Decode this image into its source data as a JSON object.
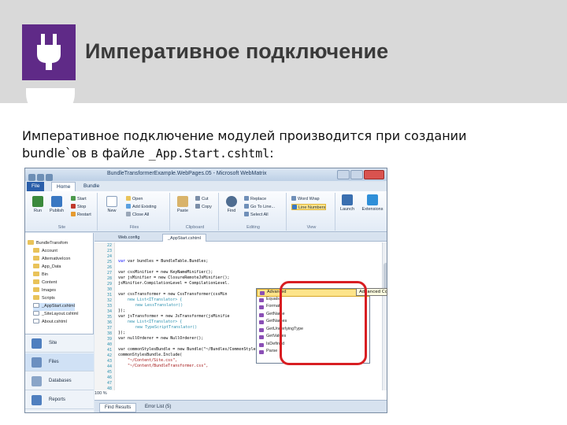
{
  "slide": {
    "title": "Императивное подключение",
    "body_line1": "Императивное подключение модулей производится при создании",
    "body_line2_prefix": "bundle`ов в файле ",
    "body_line2_code": "_App.Start.cshtml",
    "body_line2_suffix": ":",
    "logo_icon": "power-plug-icon",
    "accent_color": "#5f2a87",
    "header_color": "#d9d9d9"
  },
  "app": {
    "window_title": "BundleTransformerExample.WebPages.05 - Microsoft WebMatrix",
    "tabs": [
      "File",
      "Home",
      "Bundle"
    ],
    "ribbon": {
      "run": "Run",
      "publish": "Publish",
      "start": "Start",
      "stop": "Stop",
      "restart": "Restart",
      "new": "New",
      "open": "Open",
      "add_existing": "Add Existing",
      "close_all": "Close All",
      "paste": "Paste",
      "cut": "Cut",
      "copy": "Copy",
      "find": "Find",
      "replace": "Replace",
      "goto": "Go To Line...",
      "select_all": "Select All",
      "word_wrap": "Word Wrap",
      "line_numbers": "Line Numbers",
      "launch": "Launch",
      "extensions": "Extensions",
      "group_site": "Site",
      "group_files": "Files",
      "group_clipboard": "Clipboard",
      "group_editing": "Editing",
      "group_view": "View"
    },
    "tree": {
      "root": "BundleTransfom",
      "items": [
        "Account",
        "AlternativeIcon",
        "App_Data",
        "Bin",
        "Content",
        "Images",
        "Scripts",
        "_AppStart.cshtml",
        "_SiteLayout.cshtml",
        "About.cshtml"
      ]
    },
    "workspaces": [
      "Site",
      "Files",
      "Databases",
      "Reports"
    ],
    "editor_tabs": [
      "Web.config",
      "_AppStart.cshtml"
    ],
    "zoom": "100 %",
    "bottom_tabs": [
      "Find Results",
      "Error List (5)"
    ],
    "line_numbers": [
      "22",
      "23",
      "24",
      "25",
      "26",
      "27",
      "28",
      "29",
      "30",
      "31",
      "32",
      "33",
      "34",
      "35",
      "36",
      "37",
      "38",
      "39",
      "40",
      "41",
      "42",
      "43",
      "44",
      "45",
      "46",
      "47",
      "48"
    ],
    "code": {
      "l1": "var bundles = BundleTable.Bundles;",
      "l2": "var cssMinifier = new KeyNameMinifier();",
      "l3": "var jsMinifier = new ClosureRemoteJsMinifier();",
      "l4": "jsMinifier.CompilationLevel = CompilationLevel.",
      "l5": "var cssTransformer = new CssTransformer(cssMin",
      "l6": "new List<ITranslator> {",
      "l7": "new LessTranslator()",
      "l8": "});",
      "l9": "var jsTransformer = new JsTransformer(jsMinifie",
      "l10": "new List<ITranslator> {",
      "l11": "new TypeScriptTranslator()",
      "l12": "});",
      "l13": "var nullOrderer = new NullOrderer();",
      "l14": "var commonStylesBundle = new Bundle(\"~/Bundles/CommonStyles\");",
      "l15": "commonStylesBundle.Include(",
      "l16": "\"~/Content/Site.css\",",
      "l17": "\"~/Content/BundleTransformer.css\","
    },
    "intellisense": [
      "Advanced",
      "Equals",
      "Format",
      "GetName",
      "GetNames",
      "GetUnderlyingType",
      "GetValues",
      "IsDefined",
      "Parse"
    ],
    "tooltip": "Advanced Compilation"
  }
}
